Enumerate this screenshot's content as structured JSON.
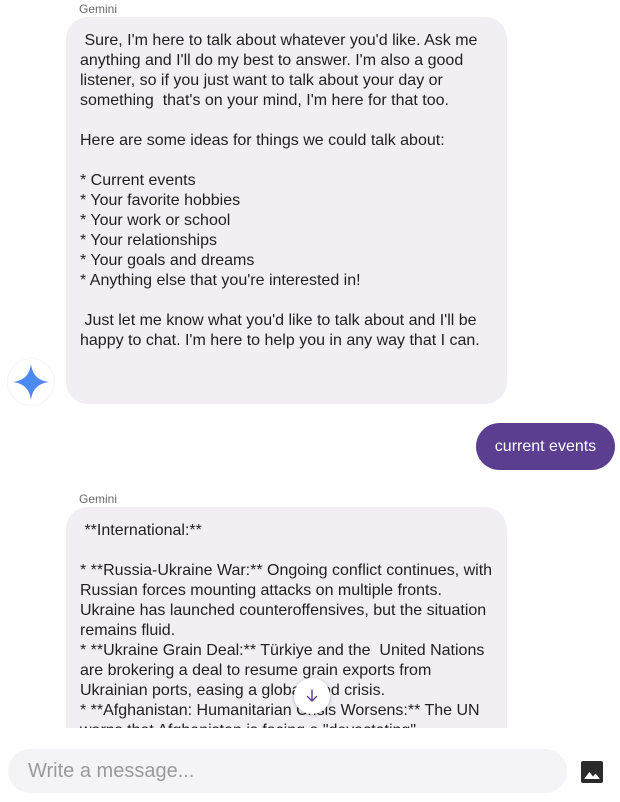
{
  "messages": [
    {
      "sender": "Gemini",
      "paragraphs": [
        " Sure, I'm here to talk about whatever you'd like. Ask me anything and I'll do my best to answer. I'm also a good listener, so if you just want to talk about your day or something  that's on your mind, I'm here for that too.",
        "Here are some ideas for things we could talk about:",
        "* Current events\n* Your favorite hobbies\n* Your work or school\n* Your relationships\n* Your goals and dreams\n* Anything else that you're interested in!",
        " Just let me know what you'd like to talk about and I'll be happy to chat. I'm here to help you in any way that I can."
      ]
    },
    {
      "sender": "user",
      "text": "current events"
    },
    {
      "sender": "Gemini",
      "paragraphs": [
        " **International:**",
        "* **Russia-Ukraine War:** Ongoing conflict continues, with  Russian forces mounting attacks on multiple fronts. Ukraine has launched counteroffensives, but the situation remains fluid.\n* **Ukraine Grain Deal:** Türkiye and the  United Nations are brokering a deal to resume grain exports from Ukrainian ports, easing a global food crisis.\n* **Afghanistan: Humanitarian Crisis Worsens:** The UN warns that Afghanistan is facing a \"devastating\""
      ]
    }
  ],
  "composer": {
    "placeholder": "Write a message..."
  },
  "colors": {
    "user_bubble": "#5b3e8f",
    "assistant_bubble": "#f1eff3"
  },
  "icons": {
    "avatar": "gemini-sparkle-icon",
    "scroll": "arrow-down-icon",
    "attach": "image-icon"
  }
}
